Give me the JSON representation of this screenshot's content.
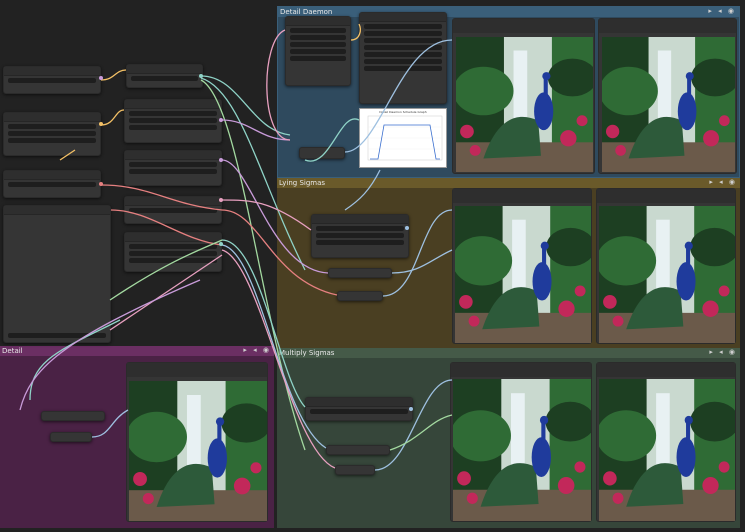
{
  "groups": {
    "detail_daemon": {
      "title": "Detail Daemon",
      "color": "#2f4a5e",
      "header": "#3a5f7a"
    },
    "lying_sigmas": {
      "title": "Lying Sigmas",
      "color": "#4a3f22",
      "header": "#6a5a2a"
    },
    "detail_group": {
      "title": "Detail",
      "color": "#4a2245",
      "header": "#6b2f63"
    },
    "multiply_sigmas": {
      "title": "Multiply Sigmas",
      "color": "#36463a",
      "header": "#455a48"
    }
  },
  "group_controls": "▸ ◂ ◉",
  "scene_colors": {
    "sky": "#c9d9cf",
    "waterfall": "#e8f1f3",
    "foliage": "#2f6b35",
    "foliage_dark": "#1d3f22",
    "peacock_blue": "#1f3b9c",
    "flowers": "#c2285a",
    "rocks": "#6b5a4a",
    "fan": "#2d5a3a"
  },
  "wire_colors": [
    "#e8a0c0",
    "#8fd3c7",
    "#c89bd9",
    "#f3c066",
    "#9ec0e0",
    "#a3d9a0",
    "#e68080"
  ],
  "graph": {
    "caption": "Detail Daemon Schedule Graph"
  }
}
